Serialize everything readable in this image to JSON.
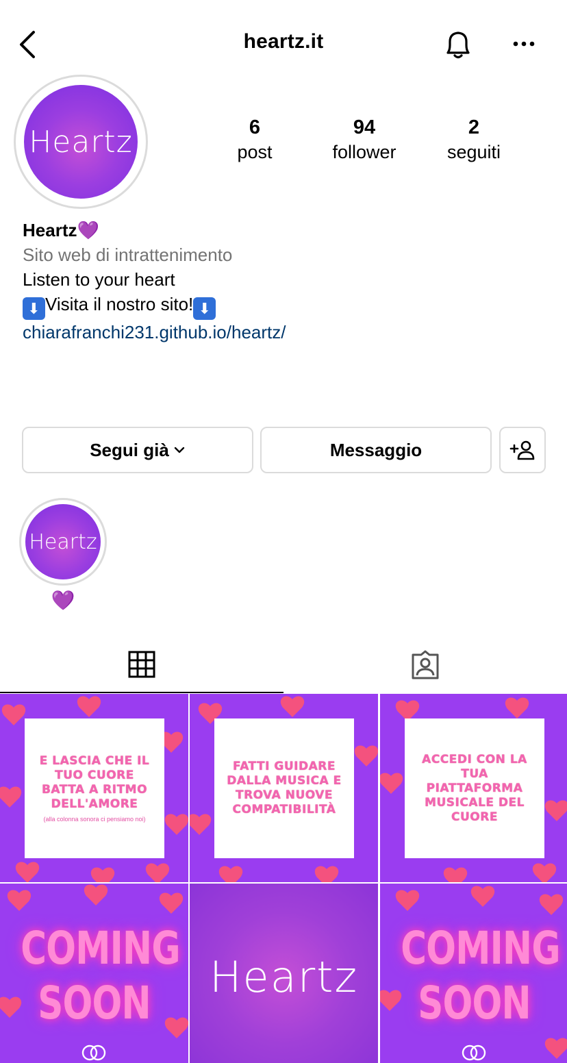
{
  "header": {
    "title": "heartz.it"
  },
  "profile": {
    "avatar_text": "Heartz",
    "stats": [
      {
        "value": "6",
        "label": "post"
      },
      {
        "value": "94",
        "label": "follower"
      },
      {
        "value": "2",
        "label": "seguiti"
      }
    ],
    "name": "Heartz💜",
    "category": "Sito web di intrattenimento",
    "bio_line1": "Listen to your heart",
    "bio_line2_emoji": "⬇",
    "bio_line2_text": "Visita il nostro sito!",
    "link": "chiarafranchi231.github.io/heartz/"
  },
  "actions": {
    "follow_label": "Segui già",
    "message_label": "Messaggio"
  },
  "highlight": {
    "cover_text": "Heartz",
    "label": "💜"
  },
  "tabs": [
    "grid-icon",
    "tagged-icon"
  ],
  "posts": [
    {
      "type": "card",
      "text": "E lascia che il tuo cuore batta a ritmo dell'amore",
      "subtext": "(alla colonna sonora ci pensiamo noi)"
    },
    {
      "type": "card",
      "text": "Fatti guidare dalla musica e trova nuove compatibilità",
      "subtext": ""
    },
    {
      "type": "card",
      "text": "Accedi con la tua piattaforma musicale del cuore",
      "subtext": ""
    },
    {
      "type": "coming",
      "text": "COMING SOON"
    },
    {
      "type": "logo",
      "text": "Heartz"
    },
    {
      "type": "coming",
      "text": "COMING SOON"
    }
  ],
  "colors": {
    "brand_purple": "#9a3df0",
    "heart_pink": "#f4527e",
    "link_blue": "#00376b"
  }
}
